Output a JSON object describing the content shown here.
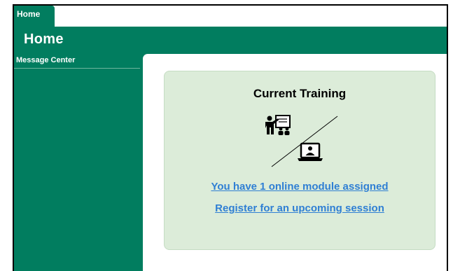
{
  "tabs": [
    {
      "label": "Home",
      "active": true
    }
  ],
  "header": {
    "title": "Home"
  },
  "sidebar": {
    "items": [
      {
        "label": "Message Center"
      }
    ]
  },
  "card": {
    "title": "Current Training",
    "graphic": {
      "icons": [
        "instructor-classroom-icon",
        "laptop-user-icon"
      ]
    },
    "links": [
      {
        "label": "You have 1 online module assigned"
      },
      {
        "label": "Register for an upcoming session"
      }
    ]
  },
  "colors": {
    "brand_green": "#017d5f",
    "card_bg": "#dcecd9",
    "link_blue": "#2f7fd4"
  }
}
